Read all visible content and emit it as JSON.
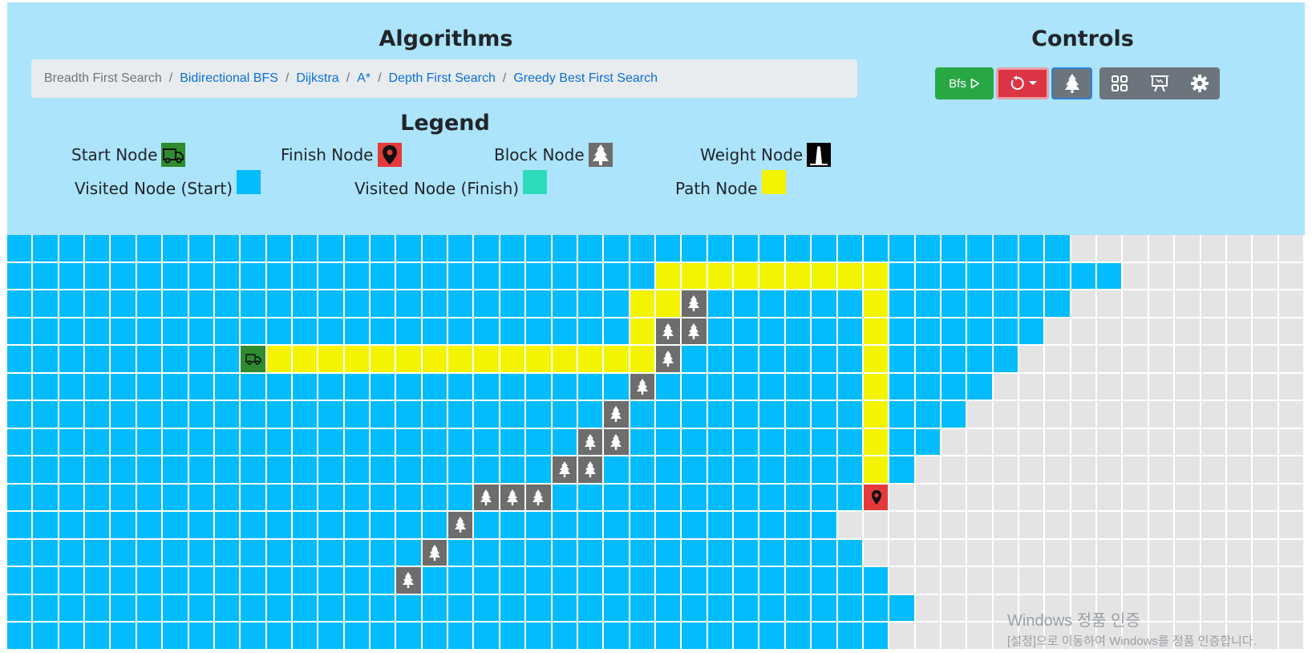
{
  "header": {
    "algorithms_title": "Algorithms",
    "controls_title": "Controls",
    "legend_title": "Legend"
  },
  "algorithms": [
    {
      "label": "Breadth First Search",
      "active": true
    },
    {
      "label": "Bidirectional BFS",
      "active": false
    },
    {
      "label": "Dijkstra",
      "active": false
    },
    {
      "label": "A*",
      "active": false
    },
    {
      "label": "Depth First Search",
      "active": false
    },
    {
      "label": "Greedy Best First Search",
      "active": false
    }
  ],
  "controls": {
    "run_label": "Bfs",
    "run_icon": "play-icon",
    "reset_icon": "reset-icon",
    "block_icon": "tree-icon",
    "tools": [
      "grid-icon",
      "presentation-icon",
      "gear-icon"
    ]
  },
  "legend": {
    "start": "Start Node",
    "finish": "Finish Node",
    "block": "Block Node",
    "weight": "Weight Node",
    "visited_start": "Visited Node (Start)",
    "visited_finish": "Visited Node (Finish)",
    "path": "Path Node"
  },
  "colors": {
    "panel": "#abe4fc",
    "visited_start": "#03bcfe",
    "visited_finish": "#2edbb9",
    "path": "#f4f400",
    "unvisited": "#e4e4e4",
    "block": "#6d6d6d",
    "start": "#2e8b2e",
    "finish": "#e53a3a",
    "run_button": "#28a745",
    "reset_button": "#dc3545",
    "tool_button": "#6c757d"
  },
  "grid": {
    "rows": 15,
    "cols": 50,
    "visited_until": [
      41,
      43,
      41,
      40,
      39,
      38,
      37,
      36,
      35,
      34,
      32,
      33,
      34,
      35,
      34
    ],
    "unvisited_cells": [
      [
        10,
        33
      ]
    ],
    "path_cells": [
      [
        1,
        25
      ],
      [
        1,
        26
      ],
      [
        1,
        27
      ],
      [
        1,
        28
      ],
      [
        1,
        29
      ],
      [
        1,
        30
      ],
      [
        1,
        31
      ],
      [
        1,
        32
      ],
      [
        1,
        33
      ],
      [
        2,
        24
      ],
      [
        2,
        25
      ],
      [
        2,
        33
      ],
      [
        3,
        24
      ],
      [
        3,
        33
      ],
      [
        4,
        10
      ],
      [
        4,
        11
      ],
      [
        4,
        12
      ],
      [
        4,
        13
      ],
      [
        4,
        14
      ],
      [
        4,
        15
      ],
      [
        4,
        16
      ],
      [
        4,
        17
      ],
      [
        4,
        18
      ],
      [
        4,
        19
      ],
      [
        4,
        20
      ],
      [
        4,
        21
      ],
      [
        4,
        22
      ],
      [
        4,
        23
      ],
      [
        4,
        24
      ],
      [
        4,
        33
      ],
      [
        5,
        33
      ],
      [
        6,
        33
      ],
      [
        7,
        33
      ],
      [
        8,
        33
      ]
    ],
    "block_cells": [
      [
        2,
        26
      ],
      [
        3,
        25
      ],
      [
        3,
        26
      ],
      [
        4,
        25
      ],
      [
        5,
        24
      ],
      [
        6,
        23
      ],
      [
        7,
        22
      ],
      [
        7,
        23
      ],
      [
        8,
        21
      ],
      [
        8,
        22
      ],
      [
        9,
        18
      ],
      [
        9,
        19
      ],
      [
        9,
        20
      ],
      [
        10,
        17
      ],
      [
        11,
        16
      ],
      [
        12,
        15
      ]
    ],
    "start": [
      4,
      9
    ],
    "finish": [
      9,
      33
    ]
  },
  "watermark": {
    "line1": "Windows 정품 인증",
    "line2": "[설정]으로 이동하여 Windows를 정품 인증합니다."
  }
}
